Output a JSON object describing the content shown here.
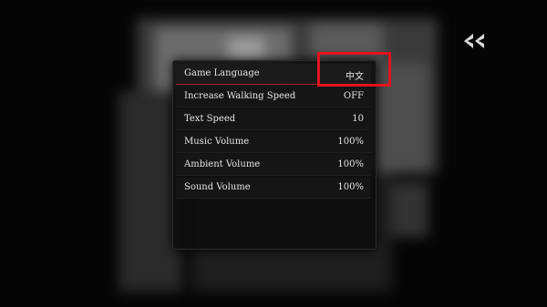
{
  "back_button": {
    "icon": "double-chevron-left-icon"
  },
  "settings": [
    {
      "label": "Game Language",
      "value": "中文"
    },
    {
      "label": "Increase Walking Speed",
      "value": "OFF"
    },
    {
      "label": "Text Speed",
      "value": "10"
    },
    {
      "label": "Music Volume",
      "value": "100%"
    },
    {
      "label": "Ambient Volume",
      "value": "100%"
    },
    {
      "label": "Sound Volume",
      "value": "100%"
    }
  ],
  "colors": {
    "highlight": "#e0141e",
    "selected_underline": "#b02020",
    "text": "#e6e6e6"
  }
}
